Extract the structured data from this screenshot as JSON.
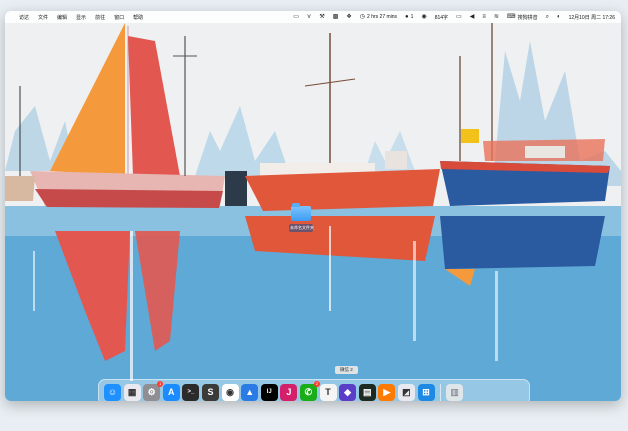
{
  "menubar": {
    "app_menus": [
      "访达",
      "文件",
      "编辑",
      "显示",
      "前往",
      "窗口",
      "帮助"
    ],
    "battery_text": "2 hrs 27 mins",
    "notification_count": "1",
    "keyboard_indicator": "814字",
    "input_source": "搜狗拼音",
    "date_time": "12月10日 周二 17:26"
  },
  "desktop": {
    "folder_label": "未命名文件夹"
  },
  "tooltip": {
    "text": "微信 2"
  },
  "dock": {
    "apps": [
      {
        "name": "Finder",
        "icon": "finder-icon",
        "color": "#1e90ff",
        "glyph": "☺",
        "running": true
      },
      {
        "name": "Launchpad",
        "icon": "launchpad-icon",
        "color": "#e9e9ef",
        "glyph": "▦"
      },
      {
        "name": "System Settings",
        "icon": "settings-icon",
        "color": "#8e8e93",
        "glyph": "⚙",
        "badge": "1"
      },
      {
        "name": "App Store",
        "icon": "appstore-icon",
        "color": "#1a8cff",
        "glyph": "A"
      },
      {
        "name": "Terminal",
        "icon": "terminal-icon",
        "color": "#2b2b2b",
        "glyph": ">_"
      },
      {
        "name": "Sublime Text",
        "icon": "sublime-icon",
        "color": "#3a3a3a",
        "glyph": "S"
      },
      {
        "name": "Google Chrome",
        "icon": "chrome-icon",
        "color": "#ffffff",
        "glyph": "◉"
      },
      {
        "name": "Keynote",
        "icon": "keynote-icon",
        "color": "#2a7be4",
        "glyph": "▲"
      },
      {
        "name": "IntelliJ IDEA",
        "icon": "intellij-icon",
        "color": "#000000",
        "glyph": "IJ"
      },
      {
        "name": "JetBrains Toolbox",
        "icon": "jetbrains-icon",
        "color": "#d4206a",
        "glyph": "J"
      },
      {
        "name": "WeChat",
        "icon": "wechat-icon",
        "color": "#1aad19",
        "glyph": "✆",
        "badge": "2"
      },
      {
        "name": "Typora",
        "icon": "typora-icon",
        "color": "#f5f5f5",
        "glyph": "T"
      },
      {
        "name": "Obsidian",
        "icon": "obsidian-icon",
        "color": "#5b3ec8",
        "glyph": "◆"
      },
      {
        "name": "Console",
        "icon": "console-icon",
        "color": "#1c2a22",
        "glyph": "▤"
      },
      {
        "name": "Infuse",
        "icon": "infuse-icon",
        "color": "#ff7a00",
        "glyph": "▶"
      },
      {
        "name": "Screenshot",
        "icon": "screenshot-icon",
        "color": "#e8e8f0",
        "glyph": "◩"
      },
      {
        "name": "Windows App",
        "icon": "windows-icon",
        "color": "#1e88e5",
        "glyph": "⊞"
      }
    ],
    "trash": {
      "name": "Trash",
      "icon": "trash-icon",
      "color": "#dfe6ea",
      "glyph": "🗑"
    }
  },
  "colors": {
    "sky": "#eef1f2",
    "water": "#5ea9d6",
    "sail_orange": "#f59a3c",
    "sail_red": "#e25850",
    "boat_red": "#e0573a",
    "boat_blue": "#2a5aa0"
  }
}
